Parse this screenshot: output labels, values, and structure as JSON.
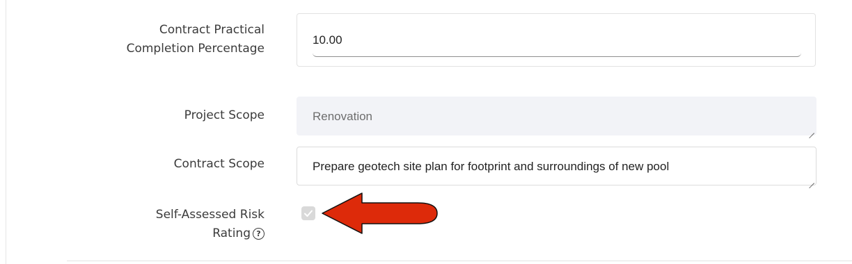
{
  "form": {
    "completion": {
      "label": "Contract Practical Completion Percentage",
      "value": "10.00"
    },
    "project_scope": {
      "label": "Project Scope",
      "value": "Renovation"
    },
    "contract_scope": {
      "label": "Contract Scope",
      "value": "Prepare geotech site plan for footprint and surroundings of new pool"
    },
    "risk_rating": {
      "label": "Self-Assessed Risk Rating",
      "checked": true,
      "disabled": true,
      "help_icon": "question-circle-icon"
    }
  },
  "annotation": {
    "arrow_color": "#dd2a0a",
    "arrow_icon": "left-arrow"
  },
  "colors": {
    "label_text": "#3b3b3b",
    "readonly_bg": "#f2f3f7",
    "checkbox_bg": "#d9d9d9"
  }
}
